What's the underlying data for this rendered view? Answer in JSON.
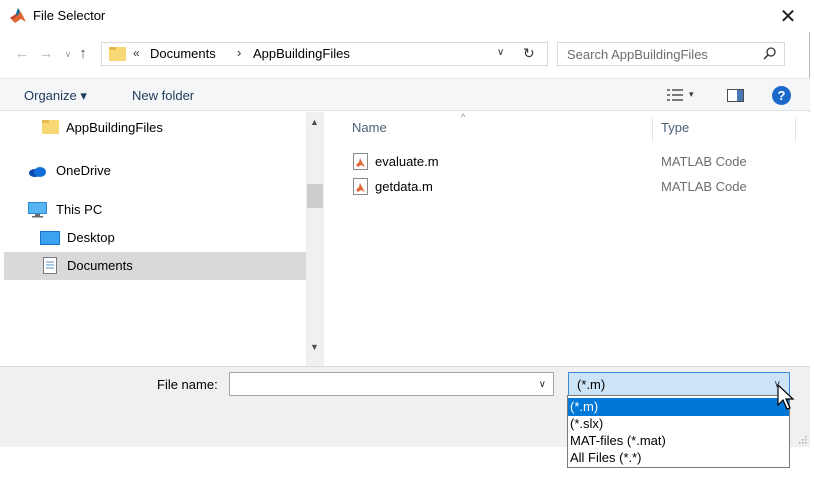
{
  "window": {
    "title": "File Selector",
    "close_glyph": "✕"
  },
  "address": {
    "back_glyph": "←",
    "forward_glyph": "→",
    "recent_glyph": "∨",
    "up_glyph": "↑",
    "chevron": "«",
    "crumbs": [
      "Documents",
      "AppBuildingFiles"
    ],
    "separator": "›",
    "dropdown_glyph": "∨",
    "refresh_glyph": "↻"
  },
  "search": {
    "placeholder": "Search AppBuildingFiles"
  },
  "toolbar": {
    "organize_label": "Organize ▾",
    "new_folder_label": "New folder",
    "view_dropdown_glyph": "▾",
    "help_glyph": "?"
  },
  "nav_pane": {
    "items": [
      {
        "label": "AppBuildingFiles",
        "icon": "folder-icon"
      },
      {
        "label": "OneDrive",
        "icon": "onedrive-icon"
      },
      {
        "label": "This PC",
        "icon": "computer-icon"
      },
      {
        "label": "Desktop",
        "icon": "desktop-icon"
      },
      {
        "label": "Documents",
        "icon": "documents-icon",
        "selected": true
      }
    ],
    "scroll_up_glyph": "▲",
    "scroll_down_glyph": "▼"
  },
  "file_list": {
    "columns": {
      "name": "Name",
      "type": "Type"
    },
    "sort_glyph": "^",
    "files": [
      {
        "name": "evaluate.m",
        "type": "MATLAB Code",
        "icon": "matlab-file-icon"
      },
      {
        "name": "getdata.m",
        "type": "MATLAB Code",
        "icon": "matlab-file-icon"
      }
    ]
  },
  "bottom": {
    "file_name_label": "File name:",
    "file_name_value": "",
    "file_name_dropdown_glyph": "∨",
    "file_type_value": "(*.m)",
    "file_type_dropdown_glyph": "∨"
  },
  "file_type_options": [
    "(*.m)",
    "(*.slx)",
    "MAT-files (*.mat)",
    "All Files (*.*)"
  ],
  "selected_option_index": 0,
  "colors": {
    "accent": "#0078d7",
    "help": "#1b6ac9",
    "selection_bg": "#d9d9d9",
    "select_highlight": "#cce4f7"
  }
}
